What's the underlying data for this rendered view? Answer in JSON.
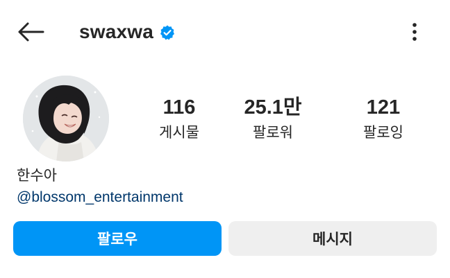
{
  "header": {
    "back_icon": "arrow-left-icon",
    "username": "swaxwa",
    "verified_icon": "verified-badge-icon",
    "more_icon": "more-vertical-icon"
  },
  "profile": {
    "avatar_icon": "profile-photo",
    "display_name": "한수아",
    "bio_link": "@blossom_entertainment"
  },
  "stats": [
    {
      "value": "116",
      "label": "게시물"
    },
    {
      "value": "25.1만",
      "label": "팔로워"
    },
    {
      "value": "121",
      "label": "팔로잉"
    }
  ],
  "actions": {
    "follow_label": "팔로우",
    "message_label": "메시지"
  },
  "colors": {
    "accent": "#0095f6",
    "verified": "#0095f6",
    "link": "#00376b",
    "secondary_button": "#efefef",
    "text": "#262626"
  }
}
